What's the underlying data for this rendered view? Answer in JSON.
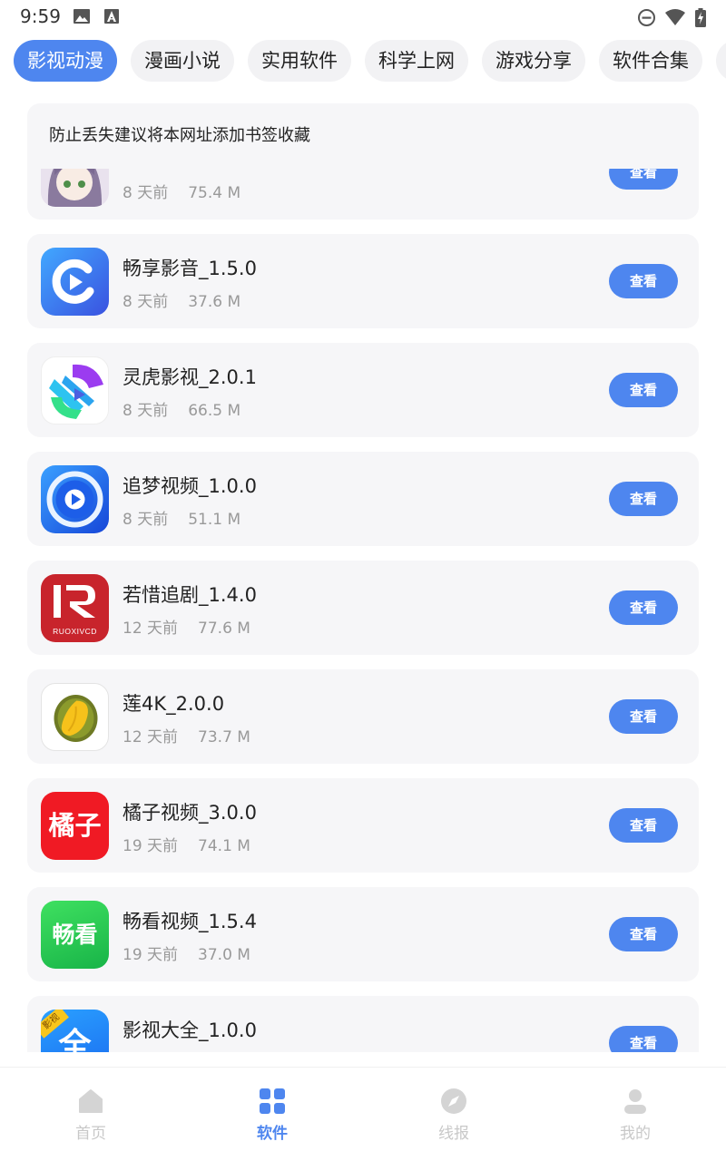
{
  "status_bar": {
    "time": "9:59"
  },
  "categories": [
    {
      "label": "影视动漫",
      "active": true
    },
    {
      "label": "漫画小说",
      "active": false
    },
    {
      "label": "实用软件",
      "active": false
    },
    {
      "label": "科学上网",
      "active": false
    },
    {
      "label": "游戏分享",
      "active": false
    },
    {
      "label": "软件合集",
      "active": false
    }
  ],
  "notice": {
    "text": "防止丢失建议将本网址添加书签收藏"
  },
  "apps": [
    {
      "name": "",
      "age": "8 天前",
      "size": "75.4 M",
      "button": "查看",
      "icon": "anime-girl-icon"
    },
    {
      "name": "畅享影音_1.5.0",
      "age": "8 天前",
      "size": "37.6 M",
      "button": "查看",
      "icon": "changxiang-play-icon"
    },
    {
      "name": "灵虎影视_2.0.1",
      "age": "8 天前",
      "size": "66.5 M",
      "button": "查看",
      "icon": "linghu-icon"
    },
    {
      "name": "追梦视频_1.0.0",
      "age": "8 天前",
      "size": "51.1 M",
      "button": "查看",
      "icon": "zhuimeng-play-icon"
    },
    {
      "name": "若惜追剧_1.4.0",
      "age": "12 天前",
      "size": "77.6 M",
      "button": "查看",
      "icon": "ruoxi-r-icon",
      "icon_text": "RUOXIVCD"
    },
    {
      "name": "莲4K_2.0.0",
      "age": "12 天前",
      "size": "73.7 M",
      "button": "查看",
      "icon": "durian-icon"
    },
    {
      "name": "橘子视频_3.0.0",
      "age": "19 天前",
      "size": "74.1 M",
      "button": "查看",
      "icon": "juzi-text-icon",
      "icon_text": "橘子"
    },
    {
      "name": "畅看视频_1.5.4",
      "age": "19 天前",
      "size": "37.0 M",
      "button": "查看",
      "icon": "changkan-text-icon",
      "icon_text": "畅看"
    },
    {
      "name": "影视大全_1.0.0",
      "age": "",
      "size": "",
      "button": "查看",
      "icon": "yingshi-daquan-icon",
      "icon_text": "全",
      "icon_badge": "影视"
    }
  ],
  "bottom_nav": [
    {
      "label": "首页",
      "icon": "home-icon",
      "active": false
    },
    {
      "label": "软件",
      "icon": "grid-icon",
      "active": true
    },
    {
      "label": "线报",
      "icon": "compass-icon",
      "active": false
    },
    {
      "label": "我的",
      "icon": "user-icon",
      "active": false
    }
  ],
  "colors": {
    "accent": "#4e86ef",
    "card_bg": "#f6f6f8",
    "chip_bg": "#f2f2f4",
    "muted_text": "#999999",
    "nav_inactive": "#c8c8c8"
  }
}
